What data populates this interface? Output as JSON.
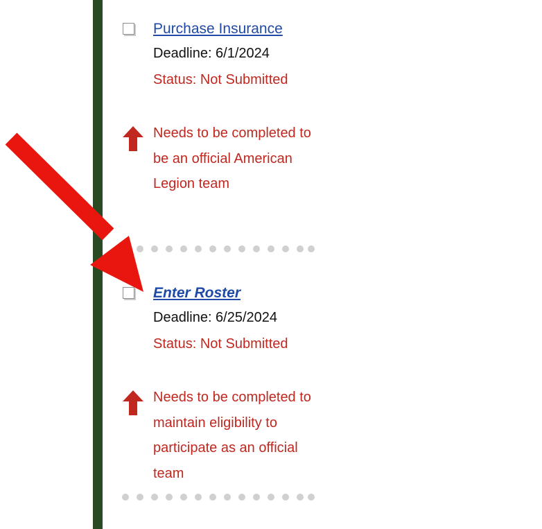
{
  "tasks": [
    {
      "title": "Purchase Insurance",
      "deadline": "Deadline: 6/1/2024",
      "status": "Status: Not Submitted",
      "warning": "Needs to be completed to be an official American Legion team"
    },
    {
      "title": "Enter Roster",
      "deadline": "Deadline: 6/25/2024",
      "status": "Status: Not Submitted",
      "warning": "Needs to be completed to maintain eligibility to participate as an official team"
    }
  ],
  "icons": {
    "warning": "up-arrow-icon",
    "annotation": "red-arrow-icon"
  },
  "colors": {
    "sidebar": "#2a4a24",
    "link": "#1f4aa6",
    "status": "#c0281f",
    "annotation": "#e8160f"
  }
}
